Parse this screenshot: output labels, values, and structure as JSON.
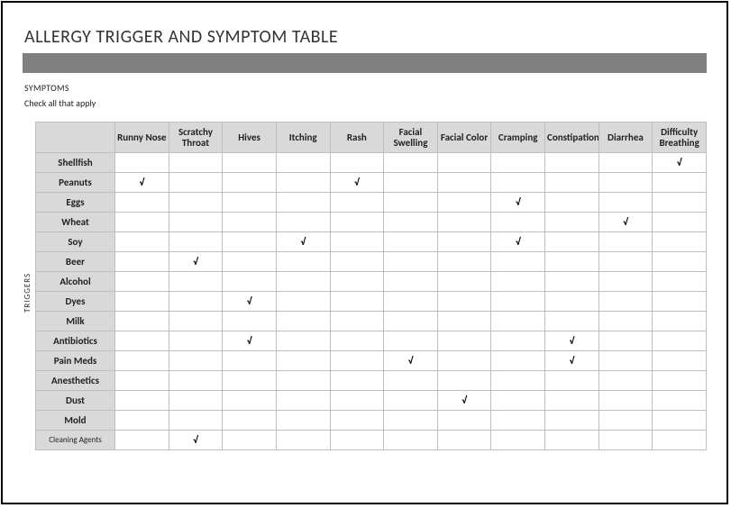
{
  "title": "ALLERGY TRIGGER AND SYMPTOM TABLE",
  "section_label": "SYMPTOMS",
  "instruction": "Check all that apply",
  "vertical_label": "TRIGGERS",
  "checkmark": "√",
  "columns": [
    "Runny Nose",
    "Scratchy Throat",
    "Hives",
    "Itching",
    "Rash",
    "Facial Swelling",
    "Facial Color",
    "Cramping",
    "Constipation",
    "Diarrhea",
    "Difficulty Breathing"
  ],
  "rows": [
    {
      "label": "Shellfish",
      "checks": [
        0,
        0,
        0,
        0,
        0,
        0,
        0,
        0,
        0,
        0,
        1
      ]
    },
    {
      "label": "Peanuts",
      "checks": [
        1,
        0,
        0,
        0,
        1,
        0,
        0,
        0,
        0,
        0,
        0
      ]
    },
    {
      "label": "Eggs",
      "checks": [
        0,
        0,
        0,
        0,
        0,
        0,
        0,
        1,
        0,
        0,
        0
      ]
    },
    {
      "label": "Wheat",
      "checks": [
        0,
        0,
        0,
        0,
        0,
        0,
        0,
        0,
        0,
        1,
        0
      ]
    },
    {
      "label": "Soy",
      "checks": [
        0,
        0,
        0,
        1,
        0,
        0,
        0,
        1,
        0,
        0,
        0
      ]
    },
    {
      "label": "Beer",
      "checks": [
        0,
        1,
        0,
        0,
        0,
        0,
        0,
        0,
        0,
        0,
        0
      ]
    },
    {
      "label": "Alcohol",
      "checks": [
        0,
        0,
        0,
        0,
        0,
        0,
        0,
        0,
        0,
        0,
        0
      ]
    },
    {
      "label": "Dyes",
      "checks": [
        0,
        0,
        1,
        0,
        0,
        0,
        0,
        0,
        0,
        0,
        0
      ]
    },
    {
      "label": "Milk",
      "checks": [
        0,
        0,
        0,
        0,
        0,
        0,
        0,
        0,
        0,
        0,
        0
      ]
    },
    {
      "label": "Antibiotics",
      "checks": [
        0,
        0,
        1,
        0,
        0,
        0,
        0,
        0,
        1,
        0,
        0
      ]
    },
    {
      "label": "Pain Meds",
      "checks": [
        0,
        0,
        0,
        0,
        0,
        1,
        0,
        0,
        1,
        0,
        0
      ]
    },
    {
      "label": "Anesthetics",
      "checks": [
        0,
        0,
        0,
        0,
        0,
        0,
        0,
        0,
        0,
        0,
        0
      ]
    },
    {
      "label": "Dust",
      "checks": [
        0,
        0,
        0,
        0,
        0,
        0,
        1,
        0,
        0,
        0,
        0
      ]
    },
    {
      "label": "Mold",
      "checks": [
        0,
        0,
        0,
        0,
        0,
        0,
        0,
        0,
        0,
        0,
        0
      ]
    },
    {
      "label": "Cleaning Agents",
      "checks": [
        0,
        1,
        0,
        0,
        0,
        0,
        0,
        0,
        0,
        0,
        0
      ],
      "small": true
    }
  ]
}
